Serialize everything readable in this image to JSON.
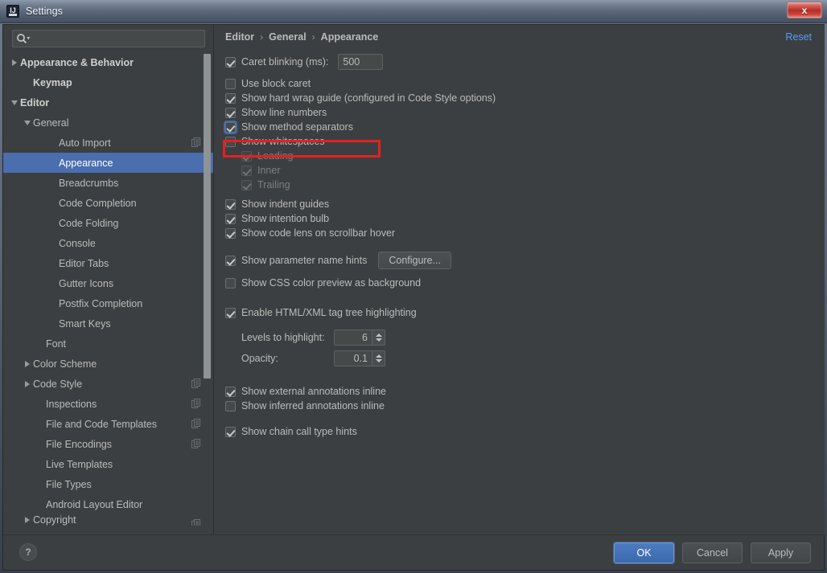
{
  "window": {
    "title": "Settings",
    "app_icon": "intellij-idea-icon",
    "close_label": "x"
  },
  "sidebar": {
    "search": {
      "placeholder": "",
      "value": "",
      "icon": "search-icon"
    },
    "items": [
      {
        "label": "Appearance & Behavior",
        "indent": 0,
        "twisty": "right",
        "bold": true,
        "selected": false,
        "copy": false
      },
      {
        "label": "Keymap",
        "indent": 1,
        "twisty": "none",
        "bold": true,
        "selected": false,
        "copy": false
      },
      {
        "label": "Editor",
        "indent": 0,
        "twisty": "down",
        "bold": true,
        "selected": false,
        "copy": false
      },
      {
        "label": "General",
        "indent": 1,
        "twisty": "down",
        "bold": false,
        "selected": false,
        "copy": false
      },
      {
        "label": "Auto Import",
        "indent": 3,
        "twisty": "none",
        "bold": false,
        "selected": false,
        "copy": true
      },
      {
        "label": "Appearance",
        "indent": 3,
        "twisty": "none",
        "bold": false,
        "selected": true,
        "copy": false
      },
      {
        "label": "Breadcrumbs",
        "indent": 3,
        "twisty": "none",
        "bold": false,
        "selected": false,
        "copy": false
      },
      {
        "label": "Code Completion",
        "indent": 3,
        "twisty": "none",
        "bold": false,
        "selected": false,
        "copy": false
      },
      {
        "label": "Code Folding",
        "indent": 3,
        "twisty": "none",
        "bold": false,
        "selected": false,
        "copy": false
      },
      {
        "label": "Console",
        "indent": 3,
        "twisty": "none",
        "bold": false,
        "selected": false,
        "copy": false
      },
      {
        "label": "Editor Tabs",
        "indent": 3,
        "twisty": "none",
        "bold": false,
        "selected": false,
        "copy": false
      },
      {
        "label": "Gutter Icons",
        "indent": 3,
        "twisty": "none",
        "bold": false,
        "selected": false,
        "copy": false
      },
      {
        "label": "Postfix Completion",
        "indent": 3,
        "twisty": "none",
        "bold": false,
        "selected": false,
        "copy": false
      },
      {
        "label": "Smart Keys",
        "indent": 3,
        "twisty": "none",
        "bold": false,
        "selected": false,
        "copy": false
      },
      {
        "label": "Font",
        "indent": 2,
        "twisty": "none",
        "bold": false,
        "selected": false,
        "copy": false
      },
      {
        "label": "Color Scheme",
        "indent": 1,
        "twisty": "right",
        "bold": false,
        "selected": false,
        "copy": false
      },
      {
        "label": "Code Style",
        "indent": 1,
        "twisty": "right",
        "bold": false,
        "selected": false,
        "copy": true
      },
      {
        "label": "Inspections",
        "indent": 2,
        "twisty": "none",
        "bold": false,
        "selected": false,
        "copy": true
      },
      {
        "label": "File and Code Templates",
        "indent": 2,
        "twisty": "none",
        "bold": false,
        "selected": false,
        "copy": true
      },
      {
        "label": "File Encodings",
        "indent": 2,
        "twisty": "none",
        "bold": false,
        "selected": false,
        "copy": true
      },
      {
        "label": "Live Templates",
        "indent": 2,
        "twisty": "none",
        "bold": false,
        "selected": false,
        "copy": false
      },
      {
        "label": "File Types",
        "indent": 2,
        "twisty": "none",
        "bold": false,
        "selected": false,
        "copy": false
      },
      {
        "label": "Android Layout Editor",
        "indent": 2,
        "twisty": "none",
        "bold": false,
        "selected": false,
        "copy": false
      },
      {
        "label": "Copyright",
        "indent": 1,
        "twisty": "right",
        "bold": false,
        "selected": false,
        "copy": true,
        "clipped": true
      }
    ]
  },
  "main": {
    "breadcrumb": [
      "Editor",
      "General",
      "Appearance"
    ],
    "breadcrumb_separator": "›",
    "reset_label": "Reset",
    "caret_blinking": {
      "label": "Caret blinking (ms):",
      "checked": true,
      "value": "500"
    },
    "options": [
      {
        "label": "Use block caret",
        "checked": false,
        "disabled": false,
        "indent": 0
      },
      {
        "label": "Show hard wrap guide (configured in Code Style options)",
        "checked": true,
        "disabled": false,
        "indent": 0
      },
      {
        "label": "Show line numbers",
        "checked": true,
        "disabled": false,
        "indent": 0
      },
      {
        "label": "Show method separators",
        "checked": true,
        "disabled": false,
        "indent": 0,
        "highlighted": true
      },
      {
        "label": "Show whitespaces",
        "checked": false,
        "disabled": false,
        "indent": 0
      },
      {
        "label": "Leading",
        "checked": true,
        "disabled": true,
        "indent": 1
      },
      {
        "label": "Inner",
        "checked": true,
        "disabled": true,
        "indent": 1
      },
      {
        "label": "Trailing",
        "checked": true,
        "disabled": true,
        "indent": 1
      }
    ],
    "options2": [
      {
        "label": "Show indent guides",
        "checked": true,
        "disabled": false
      },
      {
        "label": "Show intention bulb",
        "checked": true,
        "disabled": false
      },
      {
        "label": "Show code lens on scrollbar hover",
        "checked": true,
        "disabled": false
      }
    ],
    "parameter_hints": {
      "label": "Show parameter name hints",
      "checked": true,
      "button_label": "Configure..."
    },
    "css_preview": {
      "label": "Show CSS color preview as background",
      "checked": false
    },
    "tag_tree": {
      "label": "Enable HTML/XML tag tree highlighting",
      "checked": true
    },
    "levels": {
      "label": "Levels to highlight:",
      "value": "6"
    },
    "opacity": {
      "label": "Opacity:",
      "value": "0.1"
    },
    "annotations": [
      {
        "label": "Show external annotations inline",
        "checked": true
      },
      {
        "label": "Show inferred annotations inline",
        "checked": false
      }
    ],
    "chain_hints": {
      "label": "Show chain call type hints",
      "checked": true
    }
  },
  "footer": {
    "help_label": "?",
    "ok_label": "OK",
    "cancel_label": "Cancel",
    "apply_label": "Apply"
  },
  "colors": {
    "accent_selection": "#4b6eaf",
    "link": "#589df6",
    "highlight_rect": "#e61f1f",
    "panel_bg": "#3c3f41",
    "text": "#bbbbbb"
  }
}
